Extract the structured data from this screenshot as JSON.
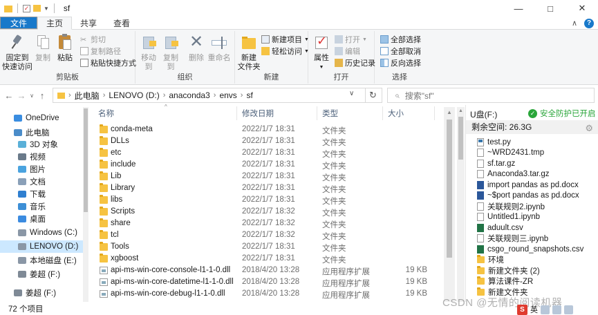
{
  "window": {
    "title": "sf",
    "controls": [
      "—",
      "□",
      "✕"
    ]
  },
  "ribbon_tabs": [
    "文件",
    "主页",
    "共享",
    "查看"
  ],
  "ribbon": {
    "clipboard": {
      "label": "剪贴板",
      "pin": "固定到\n快速访问",
      "copy": "复制",
      "paste": "粘贴",
      "cut": "剪切",
      "copy_path": "复制路径",
      "paste_shortcut": "粘贴快捷方式"
    },
    "organize": {
      "label": "组织",
      "move_to": "移动到",
      "copy_to": "复制到",
      "delete": "删除",
      "rename": "重命名"
    },
    "new": {
      "label": "新建",
      "new_folder": "新建\n文件夹",
      "new_item": "新建项目",
      "easy_access": "轻松访问"
    },
    "open": {
      "label": "打开",
      "properties": "属性",
      "open": "打开",
      "edit": "编辑",
      "history": "历史记录"
    },
    "select": {
      "label": "选择",
      "select_all": "全部选择",
      "select_none": "全部取消",
      "invert": "反向选择"
    }
  },
  "address": {
    "crumbs": [
      "此电脑",
      "LENOVO (D:)",
      "anaconda3",
      "envs",
      "sf"
    ],
    "search_placeholder": "搜索\"sf\""
  },
  "nav_pane": [
    {
      "label": "OneDrive",
      "icon": "cloud-icon"
    },
    {
      "label": "此电脑",
      "icon": "computer-icon"
    },
    {
      "label": "3D 对象",
      "icon": "cube-icon"
    },
    {
      "label": "视频",
      "icon": "video-icon"
    },
    {
      "label": "图片",
      "icon": "picture-icon"
    },
    {
      "label": "文档",
      "icon": "document-icon"
    },
    {
      "label": "下载",
      "icon": "download-icon"
    },
    {
      "label": "音乐",
      "icon": "music-icon"
    },
    {
      "label": "桌面",
      "icon": "desktop-icon"
    },
    {
      "label": "Windows (C:)",
      "icon": "drive-icon"
    },
    {
      "label": "LENOVO (D:)",
      "icon": "drive-icon"
    },
    {
      "label": "本地磁盘 (E:)",
      "icon": "drive-icon"
    },
    {
      "label": "姜超 (F:)",
      "icon": "usb-drive-icon"
    },
    {
      "label": "姜超 (F:)",
      "icon": "usb-drive-icon"
    }
  ],
  "columns": {
    "name": "名称",
    "date": "修改日期",
    "type": "类型",
    "size": "大小"
  },
  "files": [
    {
      "name": "conda-meta",
      "date": "2022/1/7 18:31",
      "type": "文件夹",
      "size": "",
      "kind": "folder"
    },
    {
      "name": "DLLs",
      "date": "2022/1/7 18:31",
      "type": "文件夹",
      "size": "",
      "kind": "folder"
    },
    {
      "name": "etc",
      "date": "2022/1/7 18:31",
      "type": "文件夹",
      "size": "",
      "kind": "folder"
    },
    {
      "name": "include",
      "date": "2022/1/7 18:31",
      "type": "文件夹",
      "size": "",
      "kind": "folder"
    },
    {
      "name": "Lib",
      "date": "2022/1/7 18:31",
      "type": "文件夹",
      "size": "",
      "kind": "folder"
    },
    {
      "name": "Library",
      "date": "2022/1/7 18:31",
      "type": "文件夹",
      "size": "",
      "kind": "folder"
    },
    {
      "name": "libs",
      "date": "2022/1/7 18:31",
      "type": "文件夹",
      "size": "",
      "kind": "folder"
    },
    {
      "name": "Scripts",
      "date": "2022/1/7 18:32",
      "type": "文件夹",
      "size": "",
      "kind": "folder"
    },
    {
      "name": "share",
      "date": "2022/1/7 18:32",
      "type": "文件夹",
      "size": "",
      "kind": "folder"
    },
    {
      "name": "tcl",
      "date": "2022/1/7 18:32",
      "type": "文件夹",
      "size": "",
      "kind": "folder"
    },
    {
      "name": "Tools",
      "date": "2022/1/7 18:31",
      "type": "文件夹",
      "size": "",
      "kind": "folder"
    },
    {
      "name": "xgboost",
      "date": "2022/1/7 18:31",
      "type": "文件夹",
      "size": "",
      "kind": "folder"
    },
    {
      "name": "api-ms-win-core-console-l1-1-0.dll",
      "date": "2018/4/20 13:28",
      "type": "应用程序扩展",
      "size": "19 KB",
      "kind": "dll"
    },
    {
      "name": "api-ms-win-core-datetime-l1-1-0.dll",
      "date": "2018/4/20 13:28",
      "type": "应用程序扩展",
      "size": "19 KB",
      "kind": "dll"
    },
    {
      "name": "api-ms-win-core-debug-l1-1-0.dll",
      "date": "2018/4/20 13:28",
      "type": "应用程序扩展",
      "size": "19 KB",
      "kind": "dll"
    }
  ],
  "side_panel": {
    "drive": "U盘(F:)",
    "protect": "安全防护已开启",
    "free_space": "剩余空间: 26.3G",
    "items": [
      {
        "name": "test.py",
        "kind": "py"
      },
      {
        "name": "~WRD2431.tmp",
        "kind": "file"
      },
      {
        "name": "sf.tar.gz",
        "kind": "file"
      },
      {
        "name": "Anaconda3.tar.gz",
        "kind": "file"
      },
      {
        "name": "import pandas as pd.docx",
        "kind": "doc"
      },
      {
        "name": "~$port pandas as pd.docx",
        "kind": "doc"
      },
      {
        "name": "关联规则2.ipynb",
        "kind": "file"
      },
      {
        "name": "Untitled1.ipynb",
        "kind": "file"
      },
      {
        "name": "aduult.csv",
        "kind": "xls"
      },
      {
        "name": "关联规则三.ipynb",
        "kind": "file"
      },
      {
        "name": "csgo_round_snapshots.csv",
        "kind": "xls"
      },
      {
        "name": "环境",
        "kind": "folder"
      },
      {
        "name": "新建文件夹 (2)",
        "kind": "folder"
      },
      {
        "name": "算法课件-ZR",
        "kind": "folder"
      },
      {
        "name": "新建文件夹",
        "kind": "folder"
      }
    ]
  },
  "status": {
    "count": "72 个项目"
  },
  "watermark": "CSDN @无情的阅读机器",
  "tray": {
    "ime": "英"
  },
  "colors": {
    "accent": "#1979ca",
    "folder": "#f6c342",
    "selection": "#cce8ff",
    "safe": "#2aa63a"
  }
}
